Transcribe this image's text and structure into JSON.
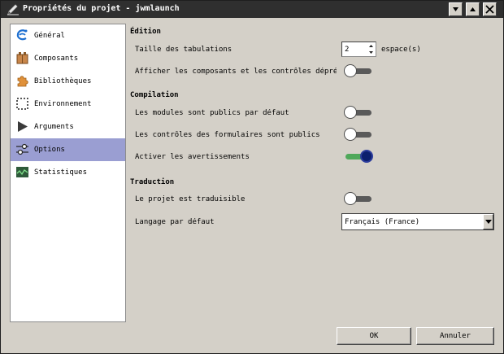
{
  "window": {
    "title": "Propriétés du projet - jwmlaunch",
    "icon": "pencil-icon",
    "controls": [
      "minimize-icon",
      "maximize-icon",
      "close-icon"
    ]
  },
  "sidebar": {
    "items": [
      {
        "label": "Général",
        "icon": "general-icon",
        "selected": false
      },
      {
        "label": "Composants",
        "icon": "components-icon",
        "selected": false
      },
      {
        "label": "Bibliothèques",
        "icon": "puzzle-icon",
        "selected": false
      },
      {
        "label": "Environnement",
        "icon": "environment-icon",
        "selected": false
      },
      {
        "label": "Arguments",
        "icon": "play-icon",
        "selected": false
      },
      {
        "label": "Options",
        "icon": "options-icon",
        "selected": true
      },
      {
        "label": "Statistiques",
        "icon": "statistics-icon",
        "selected": false
      }
    ]
  },
  "edition": {
    "title": "Édition",
    "tab_size_label": "Taille des tabulations",
    "tab_size_value": "2",
    "tab_size_unit": "espace(s)",
    "deprecated_label": "Afficher les composants et les contrôles dépréciés",
    "deprecated_on": false
  },
  "compilation": {
    "title": "Compilation",
    "modules_public_label": "Les modules sont publics par défaut",
    "modules_public_on": false,
    "controls_public_label": "Les contrôles des formulaires sont publics",
    "controls_public_on": false,
    "warnings_label": "Activer les avertissements",
    "warnings_on": true
  },
  "translation": {
    "title": "Traduction",
    "translatable_label": "Le projet est traduisible",
    "translatable_on": false,
    "default_language_label": "Langage par défaut",
    "default_language_value": "Français (France)"
  },
  "buttons": {
    "ok": "OK",
    "cancel": "Annuler"
  },
  "colors": {
    "titlebar": "#2f2f2f",
    "selection": "#9a9ed2",
    "toggle_on_track": "#4fa85a",
    "toggle_on_knob": "#0c1f6e"
  }
}
